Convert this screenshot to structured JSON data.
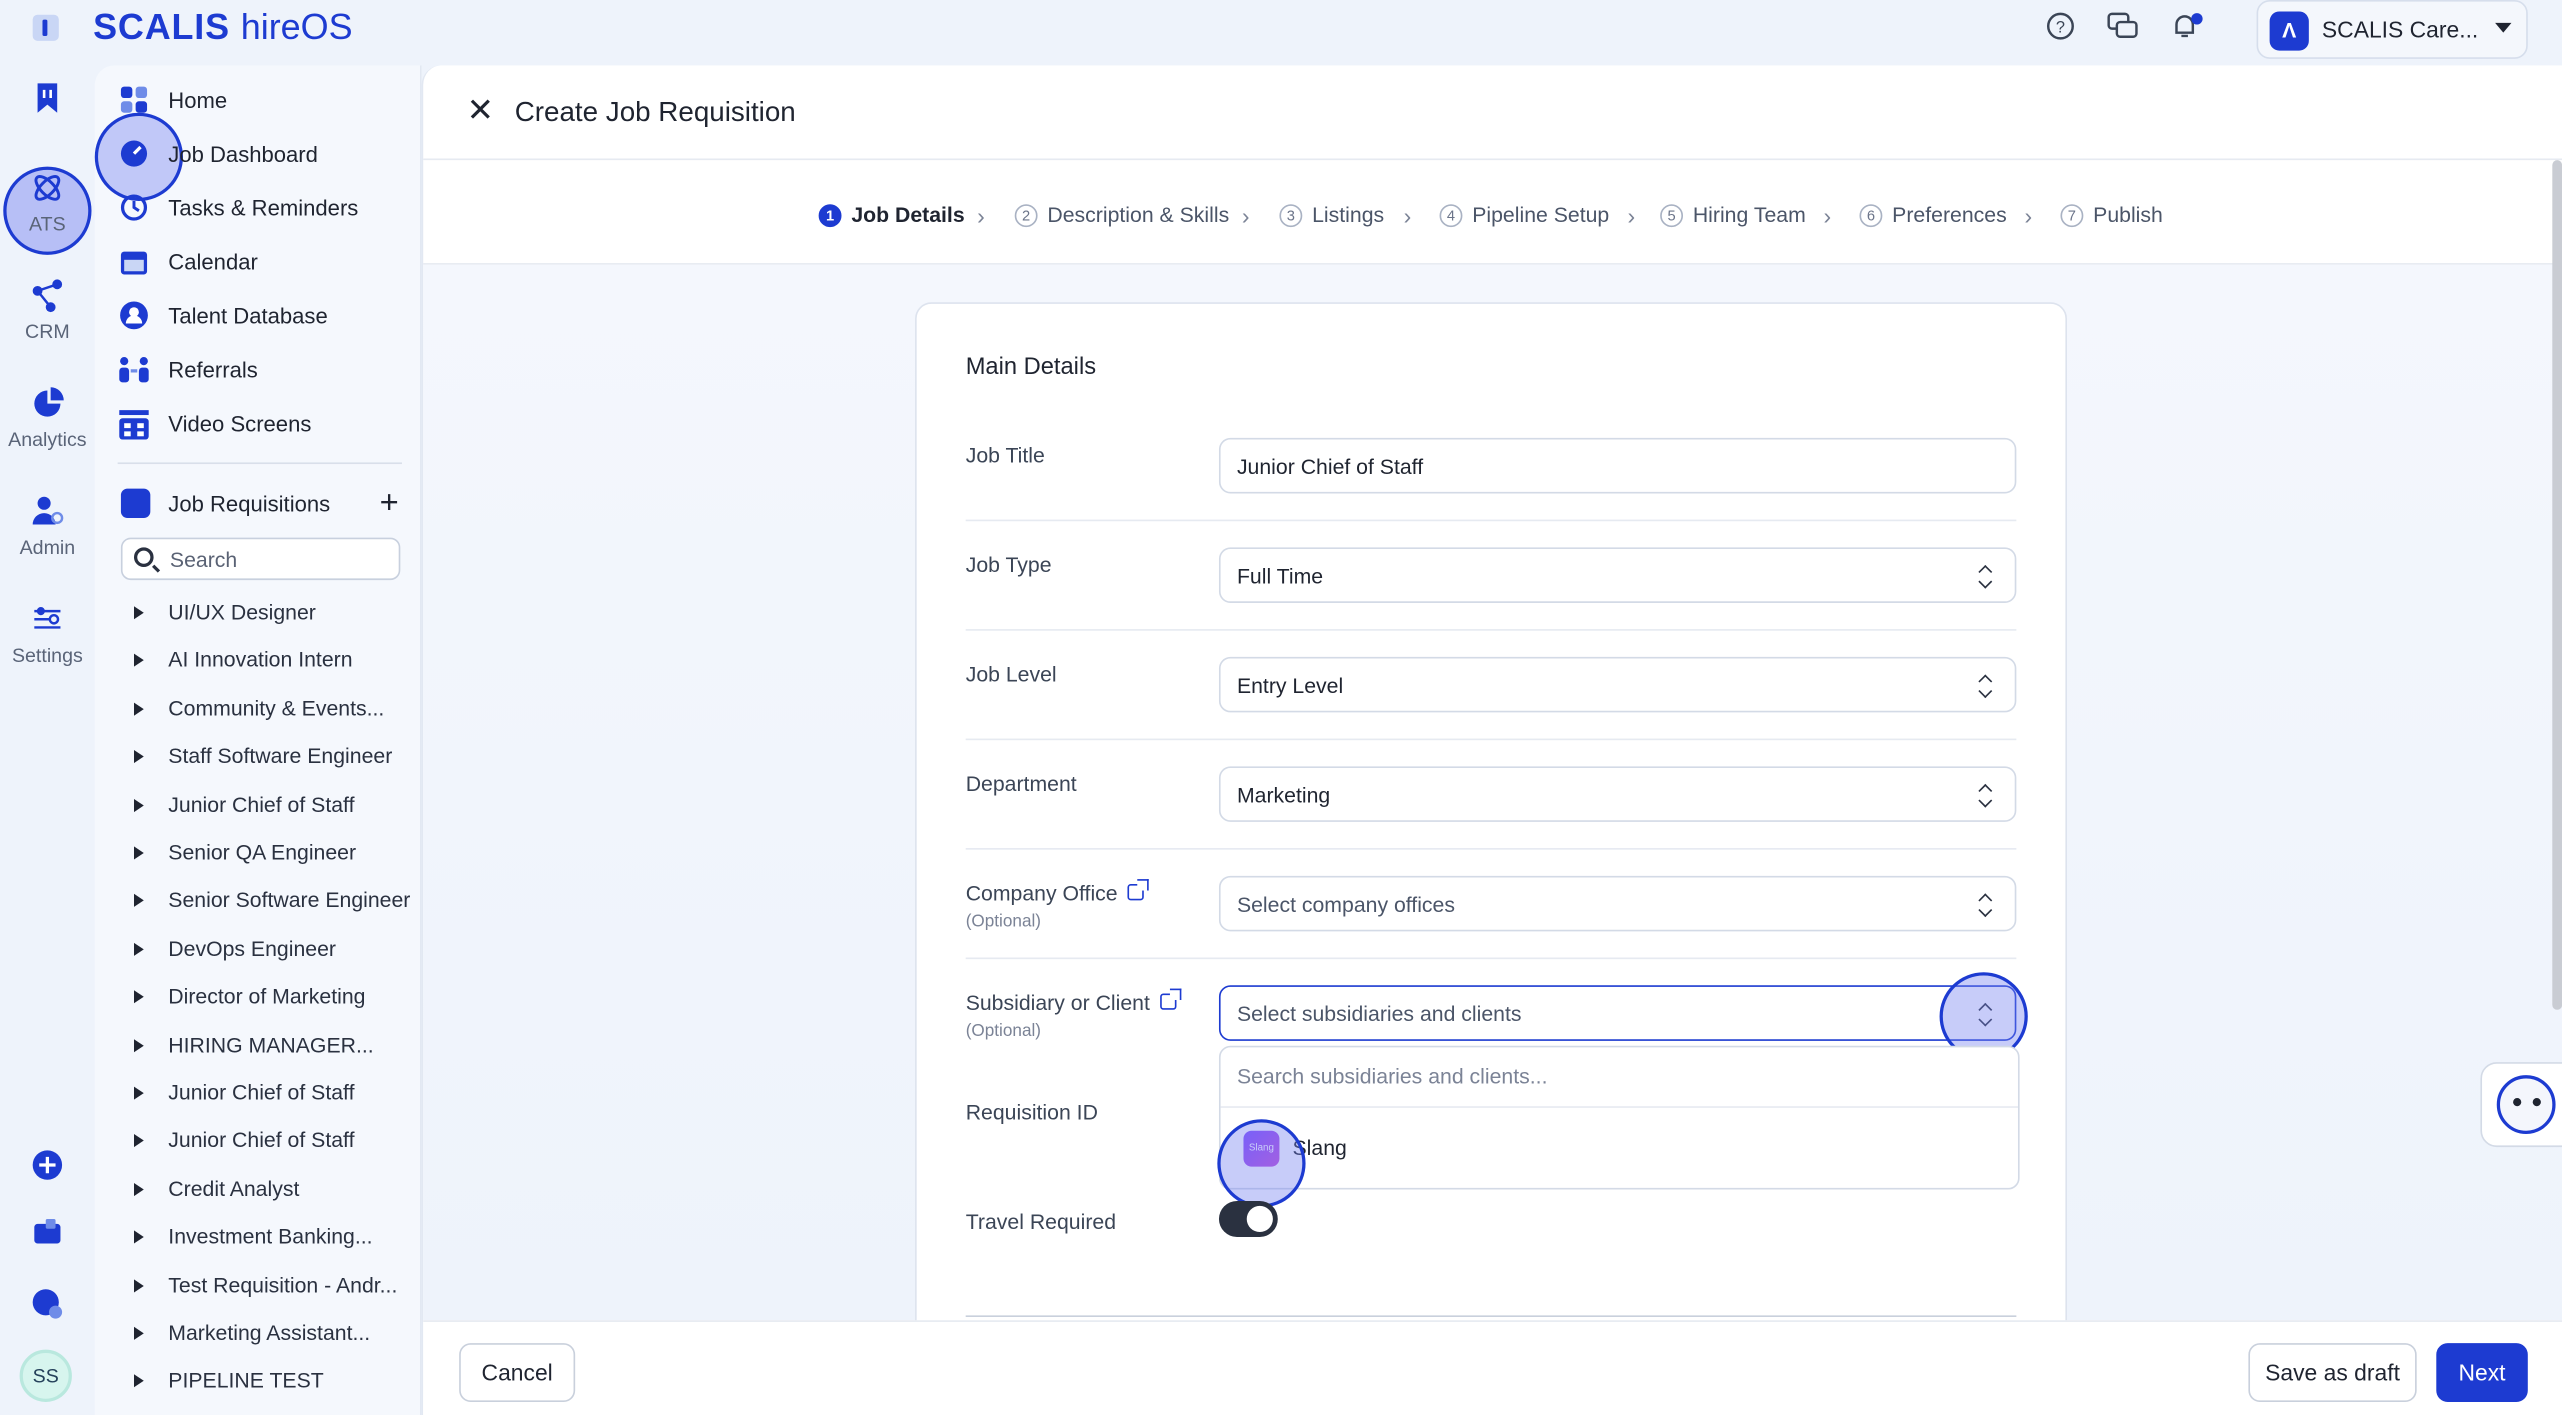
{
  "app": {
    "logo": "SCALIS",
    "product": "hireOS",
    "company": "SCALIS Care..."
  },
  "rail": {
    "items": [
      {
        "label": "ATS",
        "icon": "ats-icon"
      },
      {
        "label": "CRM",
        "icon": "crm-icon"
      },
      {
        "label": "Analytics",
        "icon": "analytics-icon"
      },
      {
        "label": "Admin",
        "icon": "admin-icon"
      },
      {
        "label": "Settings",
        "icon": "settings-icon"
      }
    ],
    "avatar": "SS"
  },
  "sidebar": {
    "nav": [
      {
        "label": "Home",
        "icon": "home-icon"
      },
      {
        "label": "Job Dashboard",
        "icon": "dashboard-icon"
      },
      {
        "label": "Tasks & Reminders",
        "icon": "tasks-icon"
      },
      {
        "label": "Calendar",
        "icon": "calendar-icon"
      },
      {
        "label": "Talent Database",
        "icon": "talent-icon"
      },
      {
        "label": "Referrals",
        "icon": "referrals-icon"
      },
      {
        "label": "Video Screens",
        "icon": "video-icon"
      }
    ],
    "job_requisitions_label": "Job Requisitions",
    "search_placeholder": "Search",
    "requisitions": [
      "UI/UX Designer",
      "AI Innovation Intern",
      "Community & Events...",
      "Staff Software Engineer",
      "Junior Chief of Staff",
      "Senior QA Engineer",
      "Senior Software Engineer",
      "DevOps Engineer",
      "Director of Marketing",
      "HIRING MANAGER...",
      "Junior Chief of Staff",
      "Junior Chief of Staff",
      "Credit Analyst",
      "Investment Banking...",
      "Test Requisition - Andr...",
      "Marketing Assistant...",
      "PIPELINE TEST"
    ]
  },
  "main": {
    "title": "Create Job Requisition",
    "steps": [
      {
        "num": "1",
        "label": "Job Details",
        "active": true
      },
      {
        "num": "2",
        "label": "Description & Skills"
      },
      {
        "num": "3",
        "label": "Listings"
      },
      {
        "num": "4",
        "label": "Pipeline Setup"
      },
      {
        "num": "5",
        "label": "Hiring Team"
      },
      {
        "num": "6",
        "label": "Preferences"
      },
      {
        "num": "7",
        "label": "Publish"
      }
    ],
    "section_title": "Main Details",
    "fields": {
      "job_title": {
        "label": "Job Title",
        "value": "Junior Chief of Staff"
      },
      "job_type": {
        "label": "Job Type",
        "value": "Full Time"
      },
      "job_level": {
        "label": "Job Level",
        "value": "Entry Level"
      },
      "department": {
        "label": "Department",
        "value": "Marketing"
      },
      "company_office": {
        "label": "Company Office",
        "optional": "(Optional)",
        "placeholder": "Select company offices"
      },
      "subsidiary": {
        "label": "Subsidiary or Client",
        "optional": "(Optional)",
        "placeholder": "Select subsidiaries and clients"
      },
      "requisition_id": {
        "label": "Requisition ID"
      },
      "travel_required": {
        "label": "Travel Required",
        "on": true
      }
    },
    "dropdown": {
      "search_placeholder": "Search subsidiaries and clients...",
      "options": [
        {
          "name": "Slang",
          "logo_text": "Slang"
        }
      ]
    },
    "footer": {
      "cancel": "Cancel",
      "save_draft": "Save as draft",
      "next": "Next"
    }
  },
  "colors": {
    "accent": "#1d3bd1",
    "background": "#eef3fb"
  }
}
